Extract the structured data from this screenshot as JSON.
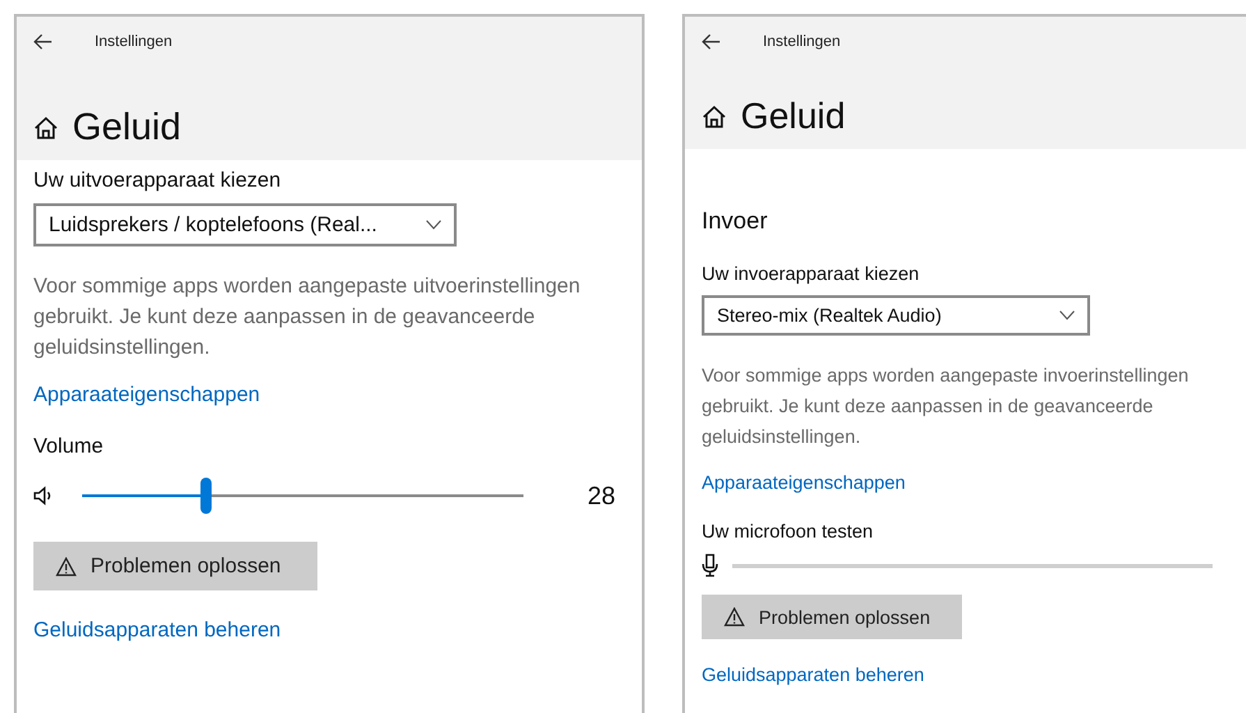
{
  "panels": [
    {
      "header": {
        "title": "Instellingen"
      },
      "page_title": "Geluid",
      "items": [
        {
          "kind": "label",
          "text": "Uw uitvoerapparaat kiezen"
        },
        {
          "kind": "dropdown",
          "value": "Luidsprekers / koptelefoons (Real..."
        },
        {
          "kind": "description",
          "text": "Voor sommige apps worden aangepaste uitvoerinstellingen gebruikt. Je kunt deze aanpassen in de geavanceerde geluidsinstellingen."
        },
        {
          "kind": "link",
          "text": "Apparaateigenschappen"
        },
        {
          "kind": "label",
          "text": "Volume"
        },
        {
          "kind": "slider",
          "level": 0.28,
          "reading": "28"
        },
        {
          "kind": "button",
          "text": "Problemen oplossen"
        },
        {
          "kind": "link",
          "text": "Geluidsapparaten beheren"
        }
      ]
    },
    {
      "header": {
        "title": "Instellingen"
      },
      "page_title": "Geluid",
      "items": [
        {
          "kind": "heading",
          "text": "Invoer"
        },
        {
          "kind": "label",
          "text": "Uw invoerapparaat kiezen"
        },
        {
          "kind": "dropdown",
          "value": "Stereo-mix (Realtek Audio)"
        },
        {
          "kind": "description",
          "text": "Voor sommige apps worden aangepaste invoerinstellingen gebruikt. Je kunt deze aanpassen in de geavanceerde geluidsinstellingen."
        },
        {
          "kind": "link",
          "text": "Apparaateigenschappen"
        },
        {
          "kind": "label",
          "text": "Uw microfoon testen"
        },
        {
          "kind": "meter",
          "level": 0
        },
        {
          "kind": "button",
          "text": "Problemen oplossen"
        },
        {
          "kind": "link",
          "text": "Geluidsapparaten beheren"
        }
      ]
    }
  ]
}
